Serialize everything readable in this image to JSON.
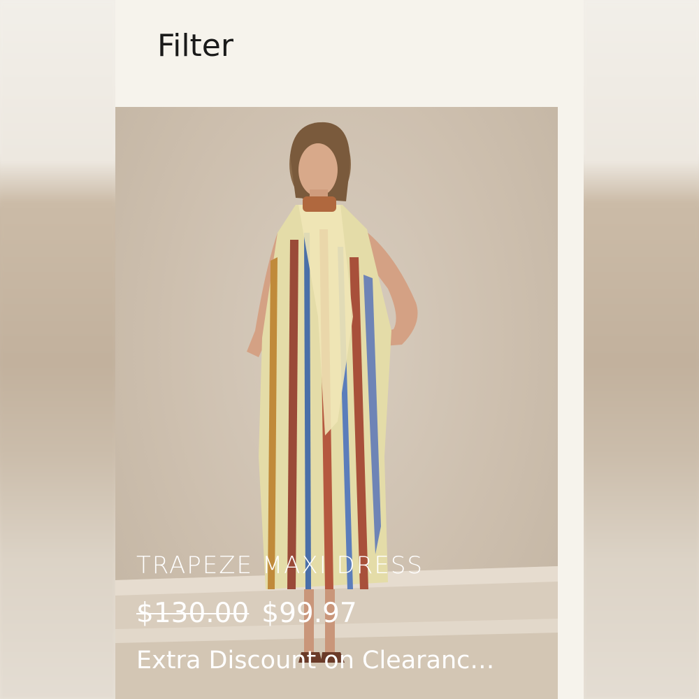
{
  "filter": {
    "label": "Filter"
  },
  "product": {
    "name": "TRAPEZE MAXI DRESS",
    "price_original": "$130.00",
    "price_sale": "$99.97",
    "promo": "Extra Discount on Clearanc…",
    "image_icon": "model-photo"
  },
  "colors": {
    "panel_bg": "#f6f3ec",
    "text_dark": "#1a1a1a",
    "overlay_text": "#ffffff",
    "photo_bg": "#cdbfae"
  }
}
